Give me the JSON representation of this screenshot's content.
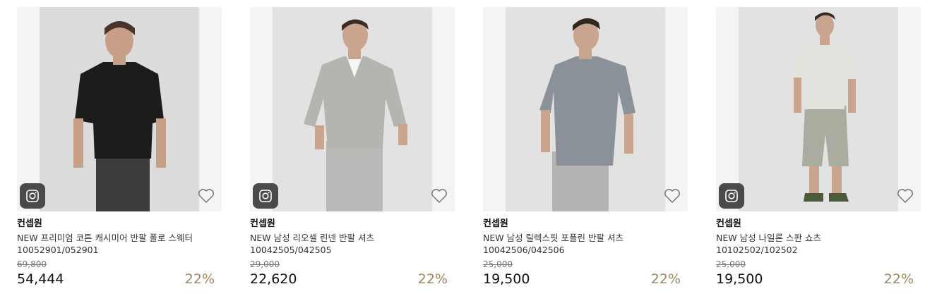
{
  "products": [
    {
      "brand": "컨셉원",
      "name": "NEW 프리미엄 코튼 캐시미어 반팔 폴로 스웨터",
      "code": "10052901/052901",
      "original_price": "69,800",
      "price": "54,444",
      "discount": "22%",
      "shirt_color": "#1c1c1c",
      "pants_color": "#3c3c3c",
      "has_instagram_badge": true
    },
    {
      "brand": "컨셉원",
      "name": "NEW 남성 리오셀 린넨 반팔 셔츠",
      "code": "10042505/042505",
      "original_price": "29,000",
      "price": "22,620",
      "discount": "22%",
      "shirt_color": "#b4b5b1",
      "pants_color": "#b9b9b7",
      "has_instagram_badge": true
    },
    {
      "brand": "컨셉원",
      "name": "NEW 남성 릴렉스핏 포플린 반팔 셔츠",
      "code": "10042506/042506",
      "original_price": "25,000",
      "price": "19,500",
      "discount": "22%",
      "shirt_color": "#8a9198",
      "pants_color": "#b3b3b3",
      "has_instagram_badge": false
    },
    {
      "brand": "컨셉원",
      "name": "NEW 남성 나일론 스판 쇼츠",
      "code": "10102502/102502",
      "original_price": "25,000",
      "price": "19,500",
      "discount": "22%",
      "shirt_color": "#e4e2dc",
      "pants_color": "#a8ada0",
      "has_instagram_badge": true
    }
  ],
  "colors": {
    "discount": "#a0885a",
    "badge_bg": "#4a4a4a",
    "image_bg": "#f4f4f4"
  },
  "icons": {
    "badge": "instagram-icon",
    "wishlist": "heart-outline-icon"
  }
}
